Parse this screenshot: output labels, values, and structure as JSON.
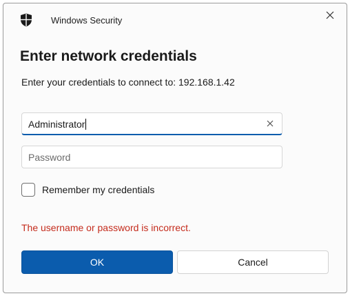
{
  "window": {
    "title": "Windows Security",
    "shield_icon": "shield-icon",
    "close_icon": "close-icon"
  },
  "dialog": {
    "heading": "Enter network credentials",
    "subtext": "Enter your credentials to connect to: 192.168.1.42"
  },
  "username": {
    "value": "Administrator",
    "clear_icon": "clear-icon"
  },
  "password": {
    "value": "",
    "placeholder": "Password"
  },
  "remember": {
    "label": "Remember my credentials",
    "checked": false
  },
  "error": {
    "message": "The username or password is incorrect."
  },
  "buttons": {
    "ok_label": "OK",
    "cancel_label": "Cancel"
  },
  "colors": {
    "accent": "#0b5cad",
    "error": "#c42b1c"
  }
}
